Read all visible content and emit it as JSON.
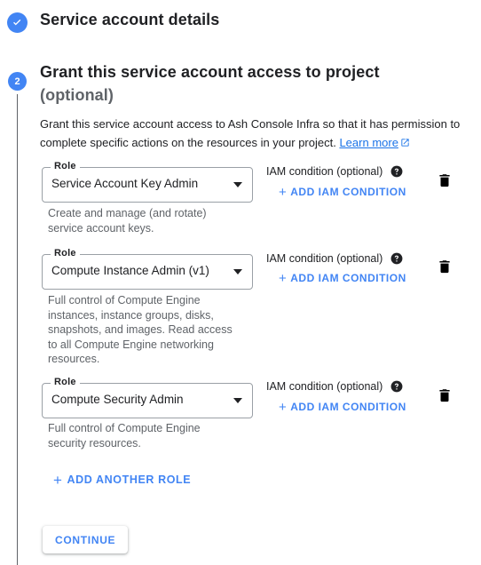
{
  "steps": {
    "step1": {
      "label": "Service account details",
      "state_icon": "check-circle-icon",
      "completed": true
    },
    "step2": {
      "number": "2",
      "label": "Grant this service account access to project",
      "optional_label": "(optional)"
    }
  },
  "intro": {
    "text_before_link": "Grant this service account access to Ash Console Infra so that it has permission to complete specific actions on the resources in your project. ",
    "link_label": "Learn more",
    "link_icon": "open-in-new-icon"
  },
  "roles": [
    {
      "field_label": "Role",
      "value": "Service Account Key Admin",
      "description": "Create and manage (and rotate) service account keys.",
      "iam_condition_label": "IAM condition (optional)",
      "help_icon": "help-circle-icon",
      "add_condition_label": "ADD IAM CONDITION",
      "delete_icon": "trash-icon"
    },
    {
      "field_label": "Role",
      "value": "Compute Instance Admin (v1)",
      "description": "Full control of Compute Engine instances, instance groups, disks, snapshots, and images. Read access to all Compute Engine networking resources.",
      "iam_condition_label": "IAM condition (optional)",
      "help_icon": "help-circle-icon",
      "add_condition_label": "ADD IAM CONDITION",
      "delete_icon": "trash-icon"
    },
    {
      "field_label": "Role",
      "value": "Compute Security Admin",
      "description": "Full control of Compute Engine security resources.",
      "iam_condition_label": "IAM condition (optional)",
      "help_icon": "help-circle-icon",
      "add_condition_label": "ADD IAM CONDITION",
      "delete_icon": "trash-icon"
    }
  ],
  "actions": {
    "add_another_role_label": "ADD ANOTHER ROLE",
    "continue_label": "CONTINUE"
  },
  "colors": {
    "accent_blue": "#4285f4",
    "link_blue": "#1a73e8",
    "text_primary": "#202124",
    "text_secondary": "#5f6368",
    "border": "#9aa0a6"
  }
}
